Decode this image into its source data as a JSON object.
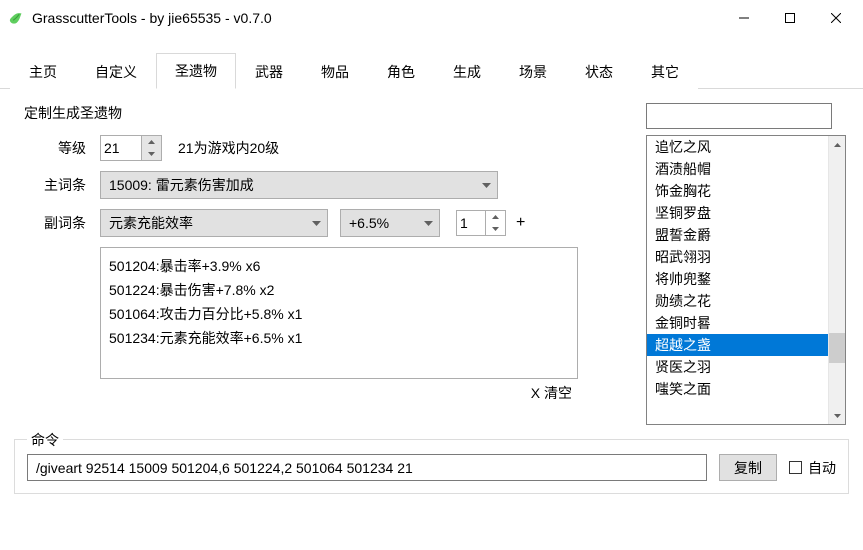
{
  "window": {
    "title": "GrasscutterTools  - by jie65535  - v0.7.0"
  },
  "tabs": [
    {
      "label": "主页"
    },
    {
      "label": "自定义"
    },
    {
      "label": "圣遗物",
      "active": true
    },
    {
      "label": "武器"
    },
    {
      "label": "物品"
    },
    {
      "label": "角色"
    },
    {
      "label": "生成"
    },
    {
      "label": "场景"
    },
    {
      "label": "状态"
    },
    {
      "label": "其它"
    }
  ],
  "artifact": {
    "section_title": "定制生成圣遗物",
    "level_label": "等级",
    "level_value": "21",
    "level_note": "21为游戏内20级",
    "mainstat_label": "主词条",
    "mainstat_value": "15009: 雷元素伤害加成",
    "substat_label": "副词条",
    "substat_name": "元素充能效率",
    "substat_value": "+6.5%",
    "count_value": "1",
    "plus_label": "+",
    "entries_text": "501204:暴击率+3.9% x6\n501224:暴击伤害+7.8% x2\n501064:攻击力百分比+5.8% x1\n501234:元素充能效率+6.5% x1",
    "clear_label": "X 清空"
  },
  "list": {
    "items": [
      "追忆之风",
      "酒渍船帽",
      "饰金胸花",
      "坚铜罗盘",
      "盟誓金爵",
      "昭武翎羽",
      "将帅兜鍪",
      "勋绩之花",
      "金铜时晷",
      "超越之盏",
      "贤医之羽",
      "嗤笑之面"
    ],
    "selected_index": 9
  },
  "command": {
    "legend": "命令",
    "value": "/giveart 92514 15009 501204,6 501224,2 501064 501234 21",
    "copy": "复制",
    "auto": "自动"
  }
}
